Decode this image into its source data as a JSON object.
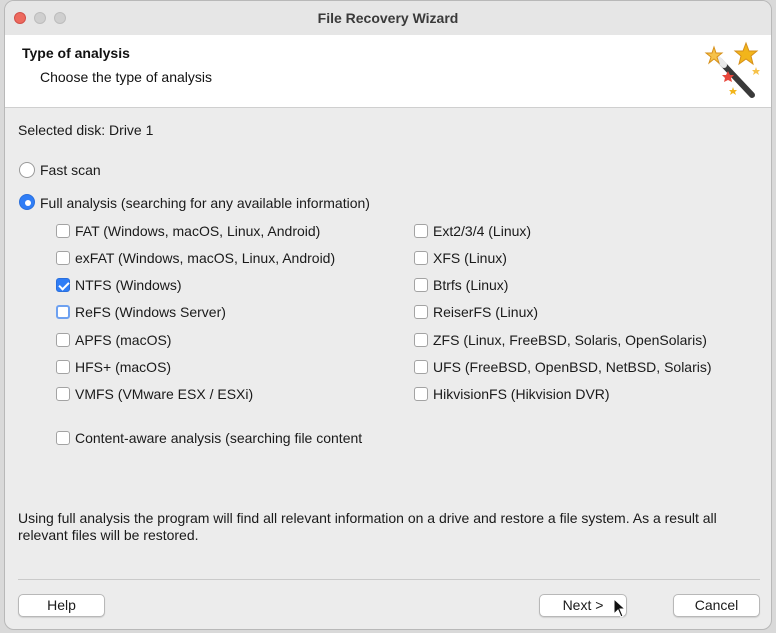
{
  "window": {
    "title": "File Recovery Wizard"
  },
  "header": {
    "title": "Type of analysis",
    "subtitle": "Choose the type of analysis"
  },
  "selected_disk": "Selected disk: Drive 1",
  "scan_options": [
    {
      "label": "Fast scan",
      "selected": false
    },
    {
      "label": "Full analysis (searching for any available information)",
      "selected": true
    }
  ],
  "filesystems_left": [
    {
      "label": "FAT (Windows, macOS, Linux, Android)",
      "checked": false
    },
    {
      "label": "exFAT (Windows, macOS, Linux, Android)",
      "checked": false
    },
    {
      "label": "NTFS (Windows)",
      "checked": true
    },
    {
      "label": "ReFS (Windows Server)",
      "checked": false
    },
    {
      "label": "APFS (macOS)",
      "checked": false
    },
    {
      "label": "HFS+ (macOS)",
      "checked": false
    },
    {
      "label": "VMFS (VMware ESX / ESXi)",
      "checked": false
    }
  ],
  "filesystems_right": [
    {
      "label": "Ext2/3/4 (Linux)",
      "checked": false
    },
    {
      "label": "XFS (Linux)",
      "checked": false
    },
    {
      "label": "Btrfs (Linux)",
      "checked": false
    },
    {
      "label": "ReiserFS (Linux)",
      "checked": false
    },
    {
      "label": "ZFS (Linux, FreeBSD, Solaris, OpenSolaris)",
      "checked": false
    },
    {
      "label": "UFS (FreeBSD, OpenBSD, NetBSD, Solaris)",
      "checked": false
    },
    {
      "label": "HikvisionFS (Hikvision DVR)",
      "checked": false
    }
  ],
  "content_aware": {
    "label": "Content-aware analysis (searching file content",
    "checked": false
  },
  "description": "Using full analysis the program will find all relevant information on a drive and restore a file system. As a result all relevant files will be restored.",
  "buttons": {
    "help": "Help",
    "next": "Next >",
    "cancel": "Cancel"
  },
  "colors": {
    "accent": "#2f7df6",
    "close": "#ed6a5e"
  }
}
